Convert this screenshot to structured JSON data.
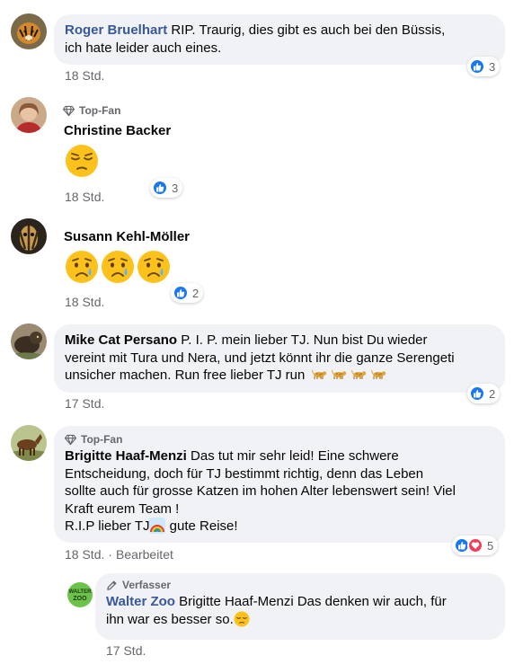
{
  "comments": [
    {
      "author": "Roger Bruelhart",
      "text": "RIP. Traurig, dies gibt es auch bei den Büssis,",
      "text2": "ich hate leider auch eines.",
      "time": "18 Std.",
      "reaction_count": "3"
    },
    {
      "badge": "Top-Fan",
      "author": "Christine Backer",
      "emoji": [
        "pensive-face"
      ],
      "time": "18 Std.",
      "reaction_count": "3"
    },
    {
      "author": "Susann Kehl-Möller",
      "emoji": [
        "sad-relieved-face",
        "sad-relieved-face",
        "sad-relieved-face"
      ],
      "time": "18 Std.",
      "reaction_count": "2"
    },
    {
      "author": "Mike Cat Persano",
      "text": "P. I. P. mein lieber TJ. Nun bist Du wieder",
      "text2": "vereint mit Tura und Nera, und jetzt könnt ihr die ganze Serengeti",
      "text3": "unsicher machen. Run free lieber TJ run",
      "trailing_emoji": [
        "leopard",
        "leopard",
        "leopard",
        "leopard"
      ],
      "time": "17 Std.",
      "reaction_count": "2"
    },
    {
      "badge": "Top-Fan",
      "author": "Brigitte Haaf-Menzi",
      "text": "Das tut mir sehr leid! Eine schwere",
      "text2": "Entscheidung, doch für TJ bestimmt richtig, denn das Leben",
      "text3": "sollte auch für grosse Katzen im hohen Alter lebenswert sein! Viel",
      "text4": "Kraft eurem Team !",
      "text5a": "R.I.P lieber TJ",
      "text5b": " gute Reise!",
      "time": "18 Std.",
      "edited": "Bearbeitet",
      "reaction_count": "5"
    }
  ],
  "reply": {
    "badge": "Verfasser",
    "author": "Walter Zoo",
    "text": "Brigitte Haaf-Menzi Das denken wir auch, für",
    "text2": "ihn war es besser so.",
    "time": "17 Std."
  },
  "colors": {
    "like": "#1877f2",
    "love": "#f33e58",
    "bubble": "#f0f2f5",
    "page_author": "#385898"
  }
}
